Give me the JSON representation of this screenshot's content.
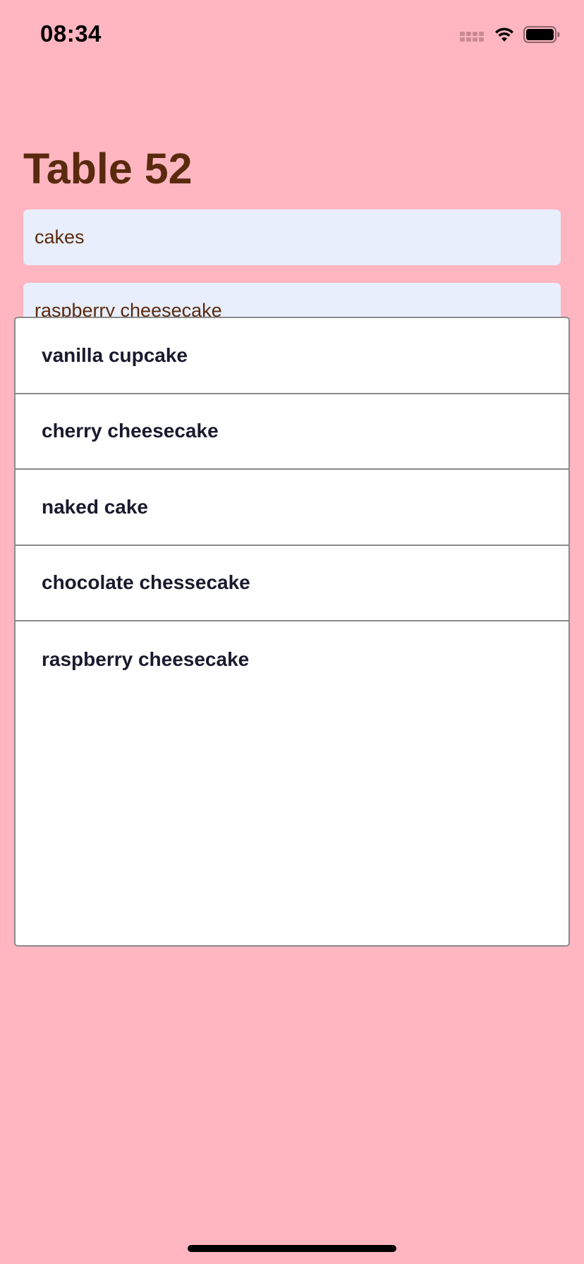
{
  "status_bar": {
    "time": "08:34",
    "icons": [
      "cellular-signal-icon",
      "wifi-icon",
      "battery-icon"
    ]
  },
  "header": {
    "title": "Table 52"
  },
  "form": {
    "category_value": "cakes",
    "item_value": "raspberry cheesecake"
  },
  "dropdown": {
    "options": [
      "vanilla cupcake",
      "cherry cheesecake",
      "naked cake",
      "chocolate chessecake",
      "raspberry cheesecake"
    ]
  },
  "colors": {
    "background": "#FFB6C1",
    "title": "#5A2A0E",
    "field_background": "#E8EEFB",
    "dropdown_background": "#FFFFFF",
    "option_text": "#1A1A2E"
  }
}
